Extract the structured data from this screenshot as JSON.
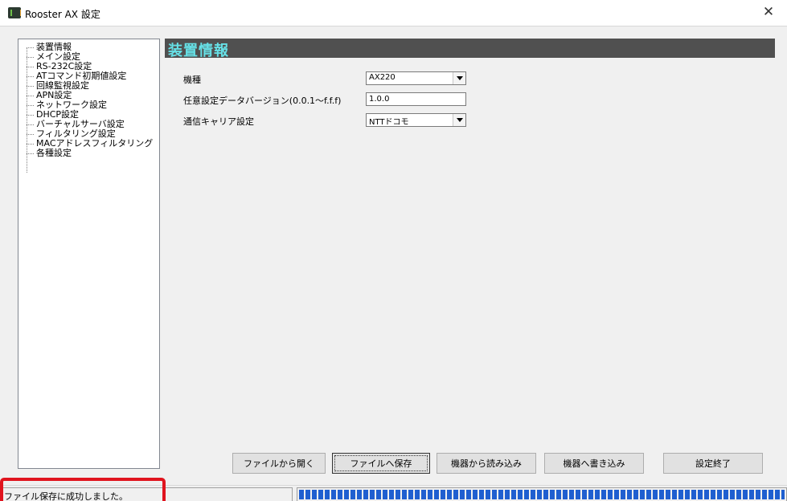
{
  "window": {
    "title": "Rooster AX 設定",
    "close_glyph": "✕"
  },
  "tree": {
    "items": [
      {
        "label": "装置情報",
        "selected": true
      },
      {
        "label": "メイン設定"
      },
      {
        "label": "RS-232C設定"
      },
      {
        "label": "ATコマンド初期値設定"
      },
      {
        "label": "回線監視設定"
      },
      {
        "label": "APN設定"
      },
      {
        "label": "ネットワーク設定"
      },
      {
        "label": "DHCP設定"
      },
      {
        "label": "バーチャルサーバ設定"
      },
      {
        "label": "フィルタリング設定"
      },
      {
        "label": "MACアドレスフィルタリング"
      },
      {
        "label": "各種設定"
      }
    ]
  },
  "section": {
    "title": "装置情報",
    "header_bg": "#505050",
    "title_color": "#66e0e6"
  },
  "form": {
    "model_label": "機種",
    "model_value": "AX220",
    "version_label": "任意設定データバージョン(0.0.1～f.f.f)",
    "version_value": "1.0.0",
    "carrier_label": "通信キャリア設定",
    "carrier_value": "NTTドコモ"
  },
  "buttons": {
    "open_file": "ファイルから開く",
    "save_file": "ファイルへ保存",
    "read_device": "機器から読み込み",
    "write_device": "機器へ書き込み",
    "finish": "設定終了"
  },
  "status": {
    "message": "ファイル保存に成功しました。",
    "progress": 1.0,
    "highlight_color": "#e0141e"
  }
}
